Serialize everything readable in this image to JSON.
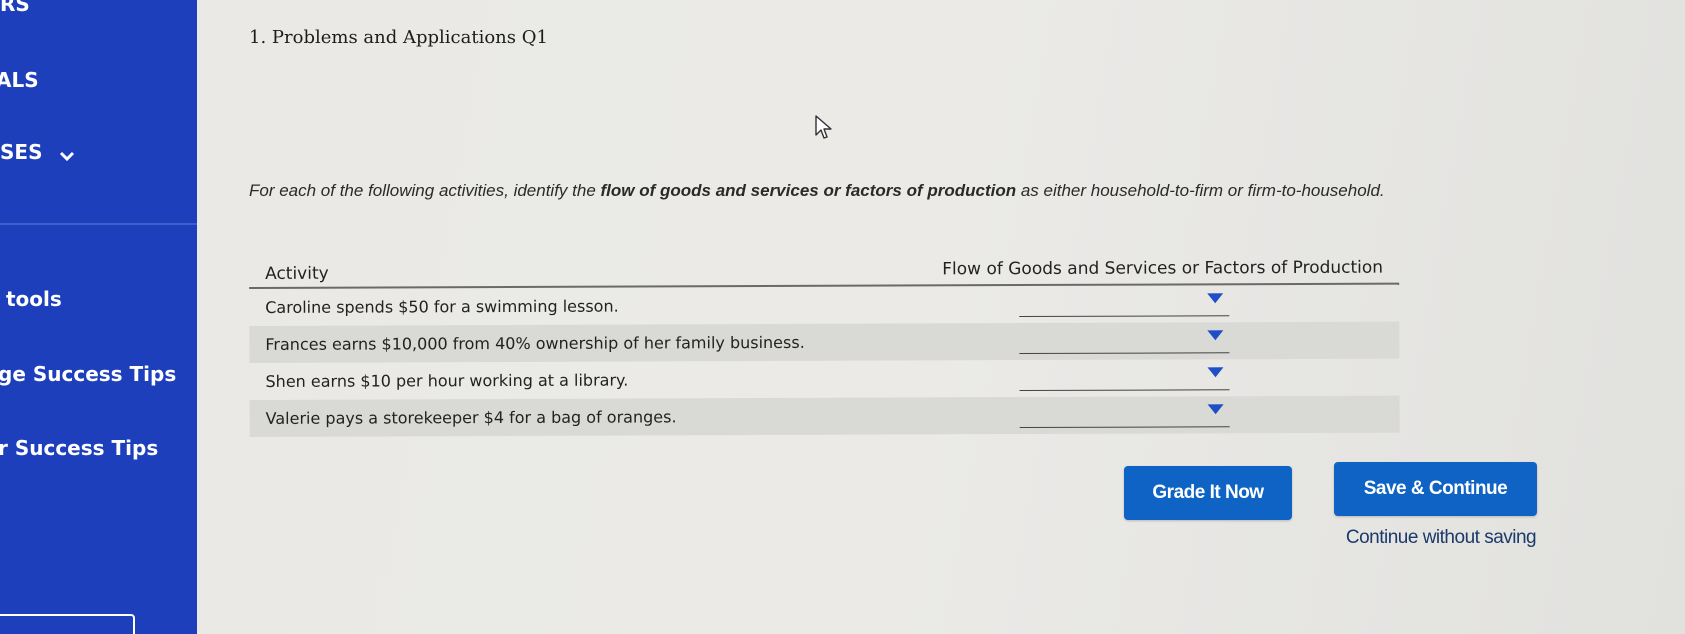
{
  "sidebar": {
    "items": [
      {
        "label": "RS"
      },
      {
        "label": "ALS"
      },
      {
        "label": "SES"
      },
      {
        "label": "tools"
      },
      {
        "label": "ge Success Tips"
      },
      {
        "label": "r Success Tips"
      }
    ]
  },
  "question": {
    "title": "1. Problems and Applications Q1",
    "instructions": {
      "part1": "For each of the following activities, identify the ",
      "bold": "flow of goods and services or factors of production",
      "part2": " as either household-to-firm or firm-to-household."
    }
  },
  "table": {
    "headers": {
      "activity": "Activity",
      "flow": "Flow of Goods and Services or Factors of Production"
    },
    "rows": [
      {
        "activity": "Caroline spends $50 for a swimming lesson.",
        "selected": ""
      },
      {
        "activity": "Frances earns $10,000 from 40% ownership of her family business.",
        "selected": ""
      },
      {
        "activity": "Shen earns $10 per hour working at a library.",
        "selected": ""
      },
      {
        "activity": "Valerie pays a storekeeper $4 for a bag of oranges.",
        "selected": ""
      }
    ]
  },
  "actions": {
    "grade_label": "Grade It Now",
    "save_label": "Save & Continue",
    "continue_label": "Continue without saving"
  },
  "colors": {
    "sidebar": "#1e3fbc",
    "button": "#0f63c4",
    "dropdown_arrow": "#1f4fc7"
  }
}
